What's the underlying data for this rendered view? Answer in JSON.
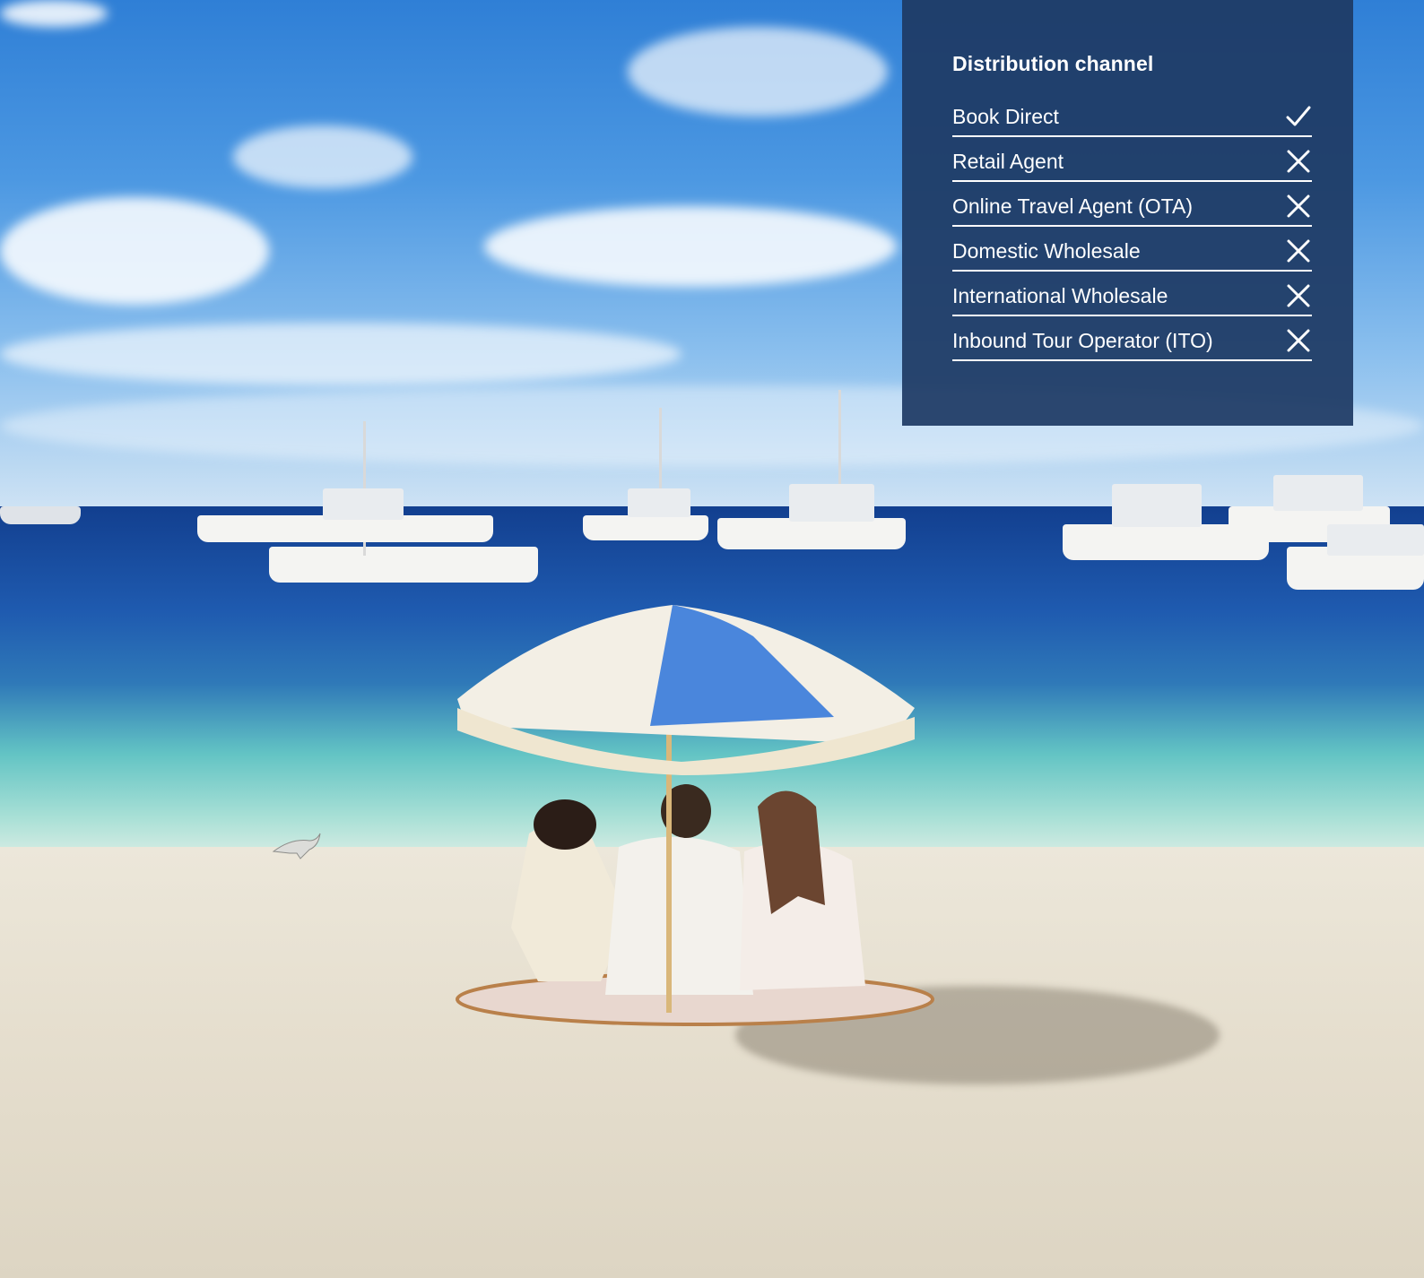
{
  "panel": {
    "title": "Distribution channel",
    "items": [
      {
        "label": "Book Direct",
        "status": "check-icon"
      },
      {
        "label": "Retail Agent",
        "status": "cross-icon"
      },
      {
        "label": "Online Travel Agent (OTA)",
        "status": "cross-icon"
      },
      {
        "label": "Domestic Wholesale",
        "status": "cross-icon"
      },
      {
        "label": "International Wholesale",
        "status": "cross-icon"
      },
      {
        "label": "Inbound Tour Operator (ITO)",
        "status": "cross-icon"
      }
    ],
    "background_color": "#1e3a64",
    "text_color": "#ffffff"
  },
  "photo": {
    "subject": "beach-umbrella-scene-icon"
  }
}
